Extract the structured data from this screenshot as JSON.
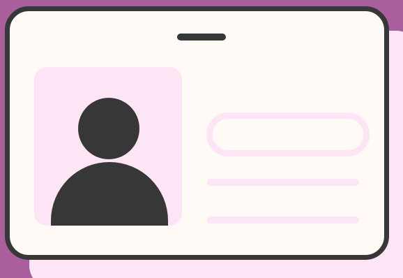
{
  "icon": {
    "name": "id-card-icon",
    "colors": {
      "background": "#a95f9b",
      "card": "#fffaf5",
      "accent": "#fde5f6",
      "outline": "#373737"
    },
    "parts": [
      "lanyard-slot",
      "user-avatar",
      "name-field",
      "detail-line",
      "detail-line"
    ]
  }
}
